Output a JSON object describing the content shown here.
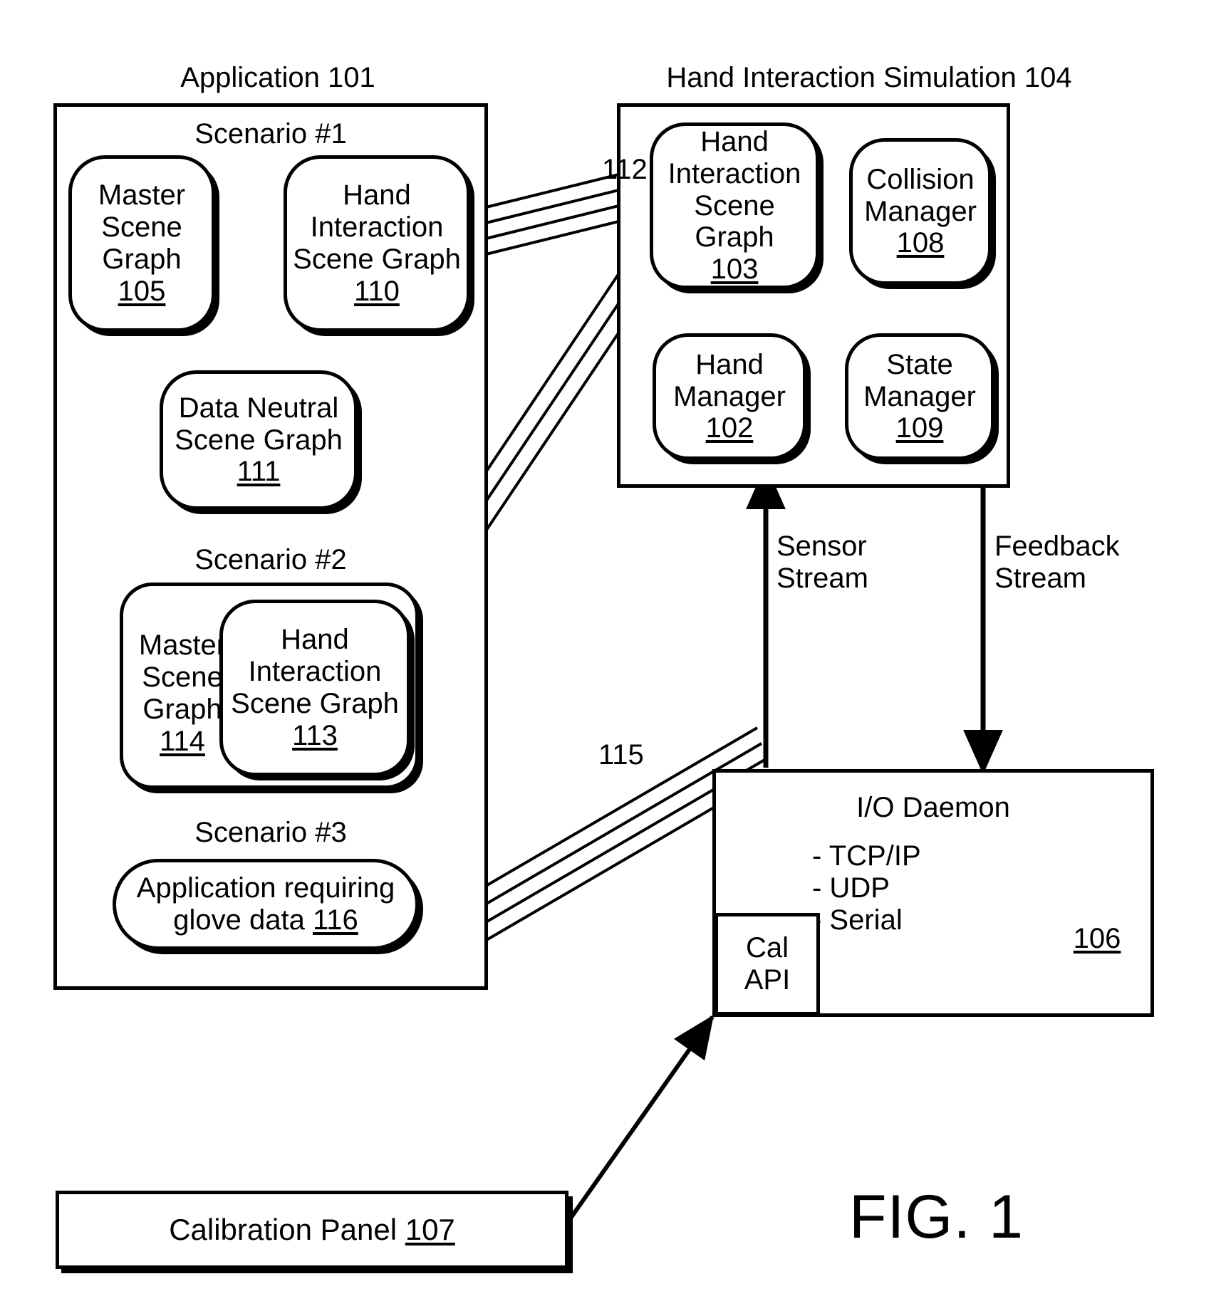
{
  "figure": {
    "label": "FIG. 1"
  },
  "application": {
    "title": "Application 101",
    "scenarios": [
      {
        "title": "Scenario #1",
        "nodes": [
          {
            "name": "Master Scene Graph",
            "line1": "Master",
            "line2": "Scene",
            "line3": "Graph",
            "number": "105"
          },
          {
            "name": "Hand Interaction Scene Graph",
            "line1": "Hand",
            "line2": "Interaction",
            "line3": "Scene Graph",
            "number": "110"
          },
          {
            "name": "Data Neutral Scene Graph",
            "line1": "Data Neutral",
            "line2": "Scene Graph",
            "line3": "",
            "number": "111"
          }
        ]
      },
      {
        "title": "Scenario #2",
        "nodes": [
          {
            "name": "Master Scene Graph",
            "line1": "Master",
            "line2": "Scene",
            "line3": "Graph",
            "number": "114"
          },
          {
            "name": "Hand Interaction Scene Graph",
            "line1": "Hand",
            "line2": "Interaction",
            "line3": "Scene Graph",
            "number": "113"
          }
        ]
      },
      {
        "title": "Scenario #3",
        "nodes": [
          {
            "name": "Application requiring glove data",
            "line1": "Application requiring",
            "line2": "glove data 116",
            "line3": "",
            "number": "116"
          }
        ]
      }
    ]
  },
  "simulation": {
    "title": "Hand Interaction Simulation 104",
    "nodes": [
      {
        "name": "Hand Interaction Scene Graph",
        "line1": "Hand",
        "line2": "Interaction",
        "line3": "Scene Graph",
        "number": "103"
      },
      {
        "name": "Collision Manager",
        "line1": "Collision",
        "line2": "Manager",
        "line3": "",
        "number": "108"
      },
      {
        "name": "Hand Manager",
        "line1": "Hand",
        "line2": "Manager",
        "line3": "",
        "number": "102"
      },
      {
        "name": "State Manager",
        "line1": "State",
        "line2": "Manager",
        "line3": "",
        "number": "109"
      }
    ]
  },
  "streams": {
    "sensor": {
      "line1": "Sensor",
      "line2": "Stream"
    },
    "feedback": {
      "line1": "Feedback",
      "line2": "Stream"
    }
  },
  "io_daemon": {
    "title": "I/O Daemon",
    "items": [
      "- TCP/IP",
      "- UDP",
      "- Serial"
    ],
    "number": "106",
    "cal_api": {
      "line1": "Cal",
      "line2": "API"
    }
  },
  "calibration_panel": {
    "text": "Calibration Panel ",
    "number": "107"
  },
  "connectors": {
    "bundle_112": "112",
    "bundle_115": "115"
  }
}
